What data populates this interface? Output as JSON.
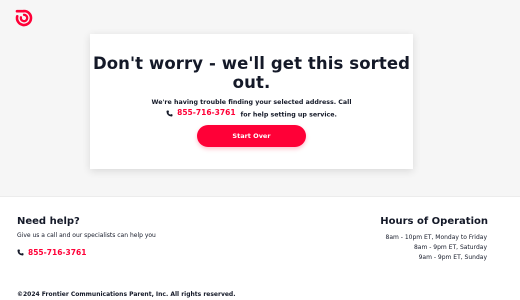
{
  "brand": {
    "accent_color": "#ff0037",
    "logo_icon": "frontier-logo-icon"
  },
  "card": {
    "headline": "Don't worry - we'll get this sorted out.",
    "message_line1": "We're having trouble finding your selected address. Call",
    "phone": "855-716-3761",
    "message_line2": "for help setting up service.",
    "button_label": "Start Over"
  },
  "footer": {
    "help_title": "Need help?",
    "help_subtitle": "Give us a call and our specialists can help you",
    "help_phone": "855-716-3761",
    "hours_title": "Hours of Operation",
    "hours": [
      "8am - 10pm ET, Monday to Friday",
      "8am - 9pm ET, Saturday",
      "9am - 9pm ET, Sunday"
    ],
    "copyright": "©2024 Frontier Communications Parent, Inc. All rights reserved."
  }
}
